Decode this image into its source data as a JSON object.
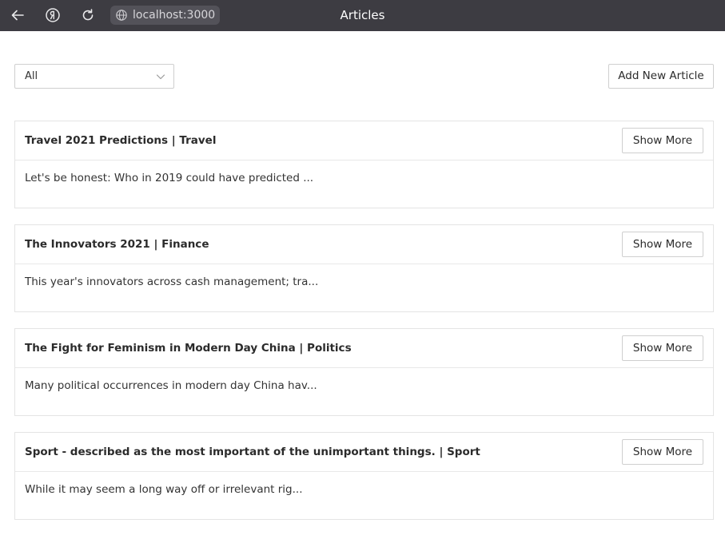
{
  "browser": {
    "url": "localhost:3000",
    "window_title": "Articles"
  },
  "toolbar": {
    "filter_value": "All",
    "add_label": "Add New Article"
  },
  "articles": [
    {
      "title": "Travel 2021 Predictions | Travel",
      "excerpt": "Let's be honest: Who in 2019 could have predicted ...",
      "button": "Show More"
    },
    {
      "title": "The Innovators 2021 | Finance",
      "excerpt": "This year's innovators across cash management; tra...",
      "button": "Show More"
    },
    {
      "title": "The Fight for Feminism in Modern Day China | Politics",
      "excerpt": "Many political occurrences in modern day China hav...",
      "button": "Show More"
    },
    {
      "title": "Sport - described as the most important of the unimportant things. | Sport",
      "excerpt": "While it may seem a long way off or irrelevant rig...",
      "button": "Show More"
    }
  ]
}
